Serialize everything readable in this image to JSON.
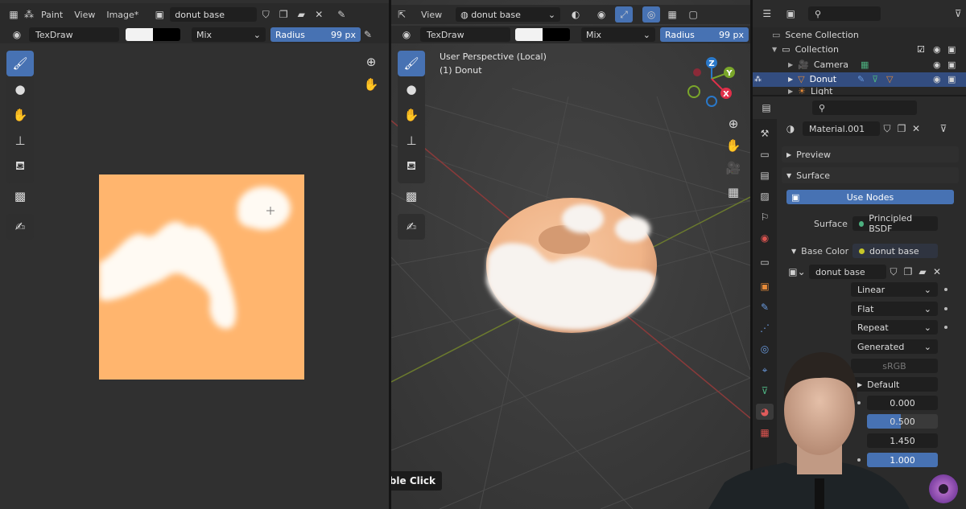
{
  "image_editor": {
    "menus": [
      "Paint",
      "View",
      "Image*"
    ],
    "image_name": "donut base",
    "brush_name": "TexDraw",
    "blend_mode": "Mix",
    "radius_label": "Radius",
    "radius_value": "99 px"
  },
  "viewport": {
    "menus": [
      "View"
    ],
    "image_name": "donut base",
    "brush_name": "TexDraw",
    "blend_mode": "Mix",
    "radius_label": "Radius",
    "radius_value": "99 px",
    "perspective_label": "User Perspective (Local)",
    "object_label": "(1) Donut",
    "gizmo": {
      "x": "X",
      "y": "Y",
      "z": "Z"
    }
  },
  "outliner": {
    "items": [
      {
        "label": "Scene Collection"
      },
      {
        "label": "Collection"
      },
      {
        "label": "Camera"
      },
      {
        "label": "Donut"
      },
      {
        "label": "Light"
      }
    ]
  },
  "properties": {
    "material_name": "Material.001",
    "panels": {
      "preview": "Preview",
      "surface": "Surface"
    },
    "use_nodes_label": "Use Nodes",
    "surface_label": "Surface",
    "surface_value": "Principled BSDF",
    "base_color_label": "Base Color",
    "base_color_value": "donut base",
    "image_name": "donut base",
    "interpolation": "Linear",
    "projection": "Flat",
    "extension": "Repeat",
    "source": "Generated",
    "color_space": "sRGB",
    "vector_label": "Default",
    "values": [
      "0.000",
      "0.500",
      "1.450",
      "1.000"
    ]
  },
  "tooltip": "Double Click",
  "colors": {
    "accent": "#4772b3",
    "texture_orange": "#ffb56e",
    "x_axis": "#e0304a",
    "y_axis": "#7aa62a",
    "z_axis": "#2a78c9"
  }
}
